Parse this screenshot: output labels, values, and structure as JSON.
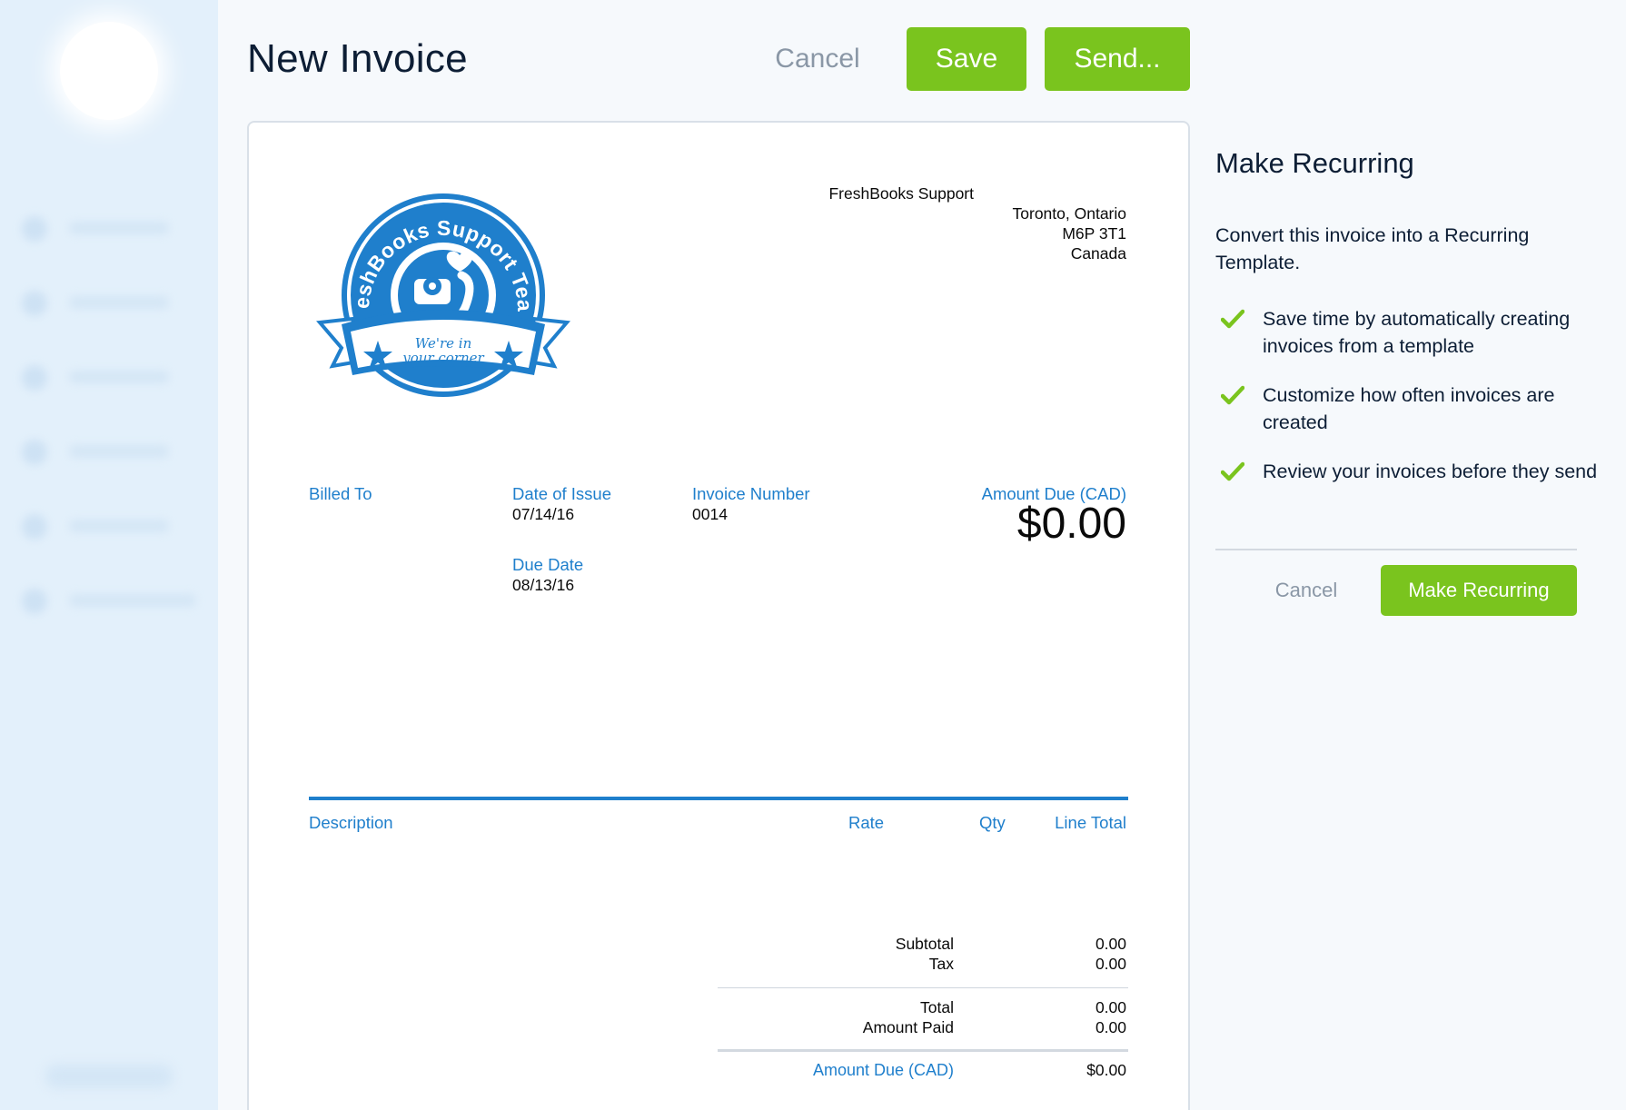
{
  "header": {
    "title": "New Invoice",
    "cancel_label": "Cancel",
    "save_label": "Save",
    "send_label": "Send..."
  },
  "invoice": {
    "from": {
      "company": "FreshBooks Support",
      "city": "Toronto, Ontario",
      "postal": "M6P 3T1",
      "country": "Canada"
    },
    "logo": {
      "arc_text": "FreshBooks Support Team",
      "banner_line1": "We're in",
      "banner_line2": "your corner"
    },
    "billed_to_label": "Billed To",
    "date_of_issue_label": "Date of Issue",
    "date_of_issue": "07/14/16",
    "due_date_label": "Due Date",
    "due_date": "08/13/16",
    "invoice_number_label": "Invoice Number",
    "invoice_number": "0014",
    "amount_due_label": "Amount Due (CAD)",
    "amount_due": "$0.00",
    "columns": {
      "description": "Description",
      "rate": "Rate",
      "qty": "Qty",
      "line_total": "Line Total"
    },
    "totals": {
      "subtotal_label": "Subtotal",
      "subtotal": "0.00",
      "tax_label": "Tax",
      "tax": "0.00",
      "total_label": "Total",
      "total": "0.00",
      "amount_paid_label": "Amount Paid",
      "amount_paid": "0.00",
      "amount_due_label": "Amount Due (CAD)",
      "amount_due": "$0.00"
    }
  },
  "recurring": {
    "title": "Make Recurring",
    "description": "Convert this invoice into a Recurring Template.",
    "benefits": [
      "Save time by automatically creating invoices from a template",
      "Customize how often invoices are created",
      "Review your invoices before they send"
    ],
    "cancel_label": "Cancel",
    "make_label": "Make Recurring"
  },
  "colors": {
    "accent_green": "#7ac41e",
    "brand_blue": "#1f7fcc",
    "text_dark": "#0d1e35",
    "muted": "#8a97a6"
  }
}
